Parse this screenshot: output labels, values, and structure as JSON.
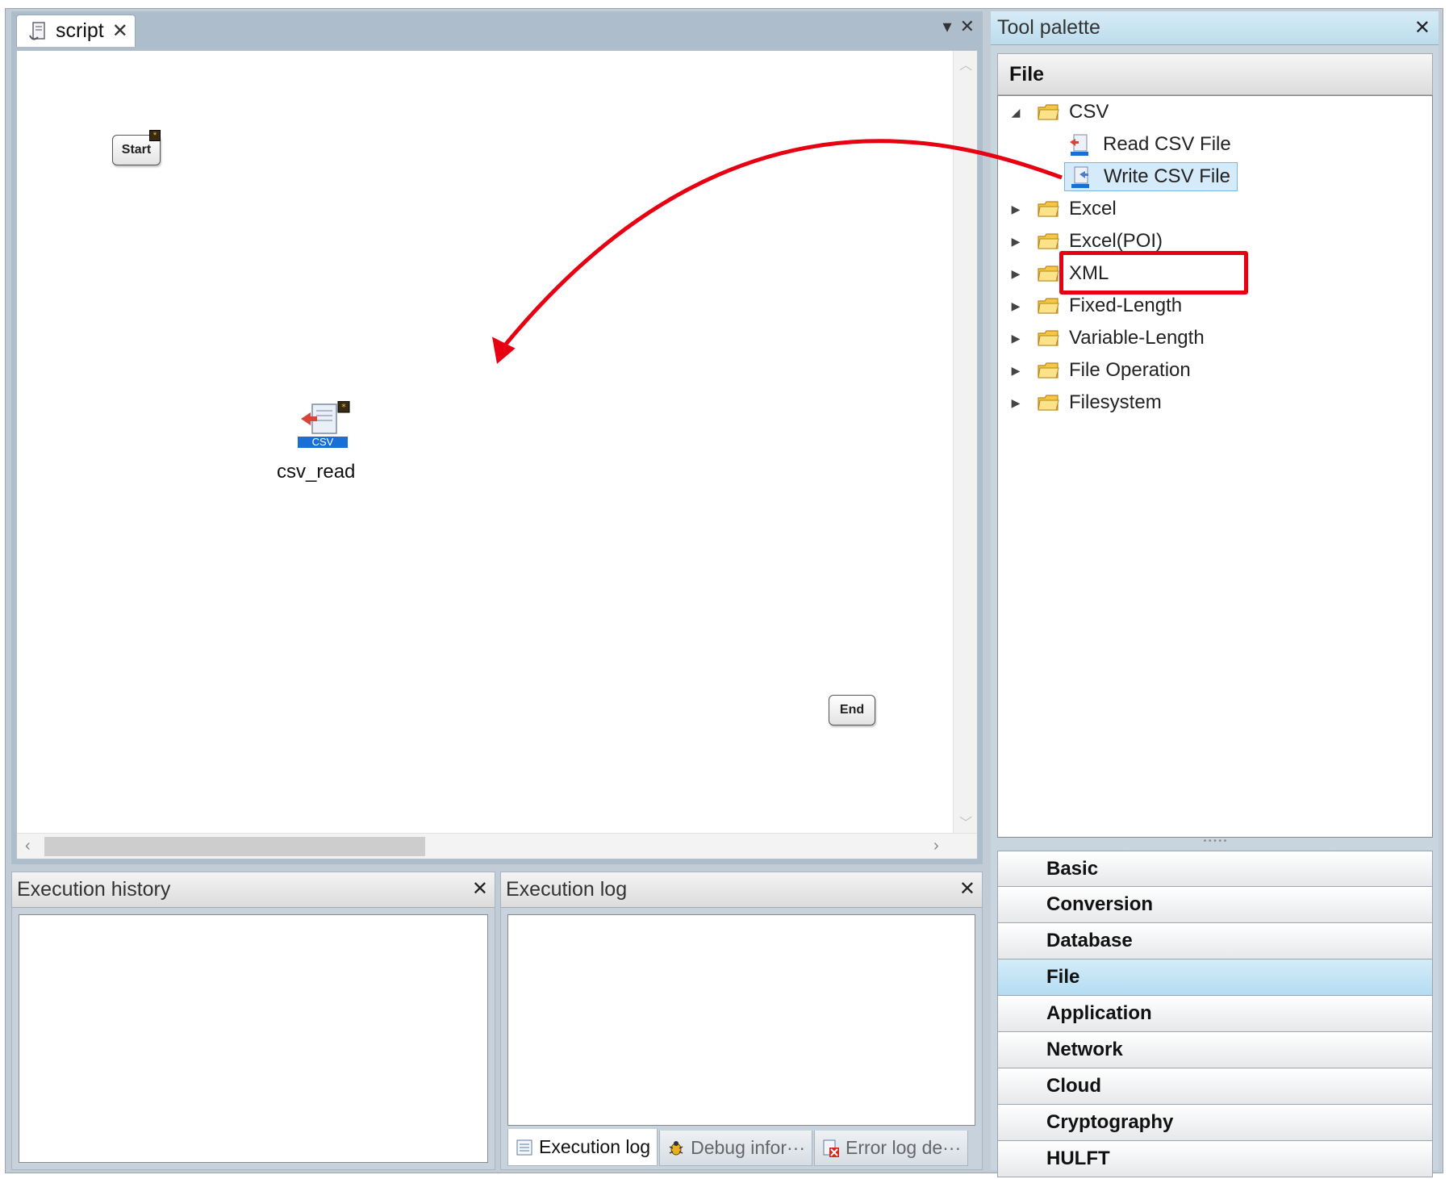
{
  "editor": {
    "tab_label": "script",
    "nodes": {
      "start_label": "Start",
      "end_label": "End",
      "component_icon_text": "CSV",
      "component_label": "csv_read"
    }
  },
  "palette": {
    "title": "Tool palette",
    "section_title": "File",
    "tree": [
      {
        "label": "CSV",
        "type": "folder",
        "expanded": true
      },
      {
        "label": "Read CSV File",
        "type": "component"
      },
      {
        "label": "Write CSV File",
        "type": "component",
        "selected": true
      },
      {
        "label": "Excel",
        "type": "folder"
      },
      {
        "label": "Excel(POI)",
        "type": "folder"
      },
      {
        "label": "XML",
        "type": "folder"
      },
      {
        "label": "Fixed-Length",
        "type": "folder"
      },
      {
        "label": "Variable-Length",
        "type": "folder"
      },
      {
        "label": "File Operation",
        "type": "folder"
      },
      {
        "label": "Filesystem",
        "type": "folder"
      }
    ],
    "categories": [
      "Basic",
      "Conversion",
      "Database",
      "File",
      "Application",
      "Network",
      "Cloud",
      "Cryptography",
      "HULFT"
    ],
    "active_category": "File"
  },
  "execution_history": {
    "title": "Execution history"
  },
  "execution_log": {
    "title": "Execution log",
    "tabs": [
      "Execution log",
      "Debug infor···",
      "Error log de···"
    ]
  },
  "colors": {
    "annotation": "#e60012",
    "selection": "#d6ebfa",
    "active_category": "#b4dcf2"
  }
}
